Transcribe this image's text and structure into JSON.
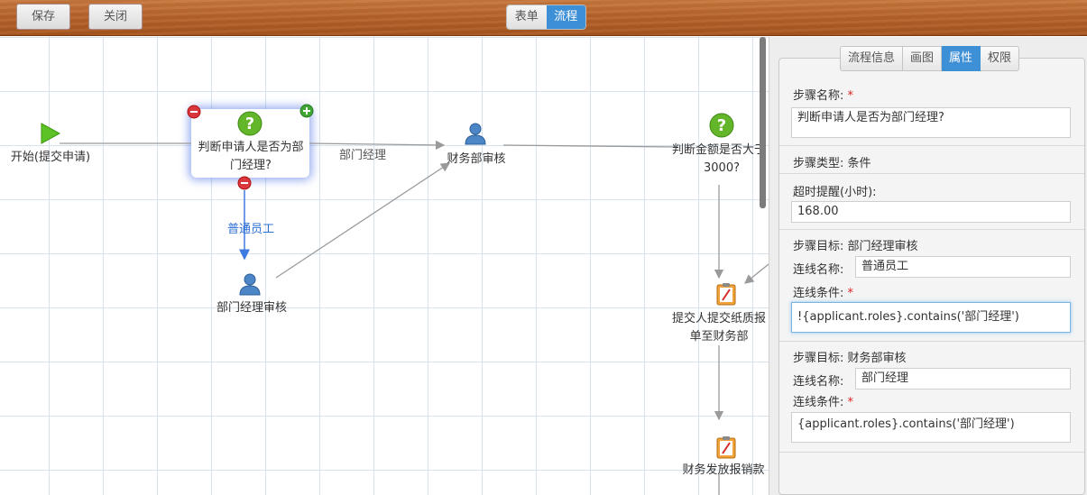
{
  "toolbar": {
    "save_label": "保存",
    "close_label": "关闭",
    "view_toggle": {
      "form_label": "表单",
      "flow_label": "流程",
      "active": "流程"
    }
  },
  "canvas": {
    "nodes": {
      "start": "开始(提交申请)",
      "cond1_line1": "判断申请人是否为部",
      "cond1_line2": "门经理?",
      "finance_review": "财务部审核",
      "cond2_line1": "判断金额是否大于",
      "cond2_line2": "3000?",
      "dept_review": "部门经理审核",
      "submit_line1": "提交人提交纸质报",
      "submit_line2": "单至财务部",
      "payout": "财务发放报销款"
    },
    "links": {
      "to_finance": "部门经理",
      "to_dept": "普通员工"
    },
    "colors": {
      "link_label_selected": "#2b6fd6",
      "link_label": "#555555"
    }
  },
  "panel": {
    "tabs": [
      "流程信息",
      "画图",
      "属性",
      "权限"
    ],
    "active_tab": "属性",
    "step_name_label": "步骤名称:",
    "step_name_value": "判断申请人是否为部门经理?",
    "step_type_label": "步骤类型: 条件",
    "timeout_label": "超时提醒(小时):",
    "timeout_value": "168.00",
    "target1": {
      "title": "步骤目标: 部门经理审核",
      "link_name_label": "连线名称:",
      "link_name_value": "普通员工",
      "condition_label": "连线条件:",
      "condition_value": "!{applicant.roles}.contains('部门经理')"
    },
    "target2": {
      "title": "步骤目标: 财务部审核",
      "link_name_label": "连线名称:",
      "link_name_value": "部门经理",
      "condition_label": "连线条件:",
      "condition_value": "{applicant.roles}.contains('部门经理')"
    },
    "required_mark": "*"
  }
}
